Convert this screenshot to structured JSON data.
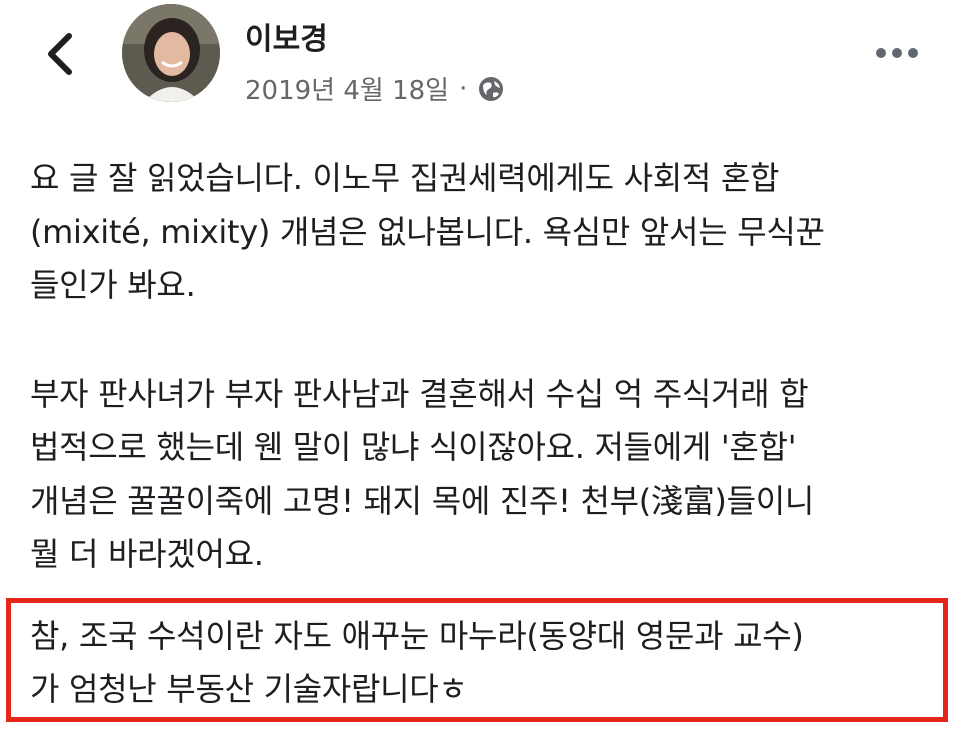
{
  "header": {
    "back_icon": "chevron-left-icon",
    "author_name": "이보경",
    "date": "2019년 4월 18일",
    "separator": "·",
    "privacy_icon": "globe-icon",
    "more_icon": "more-horizontal-icon"
  },
  "post": {
    "para1": "요 글 잘 읽었습니다. 이노무 집권세력에게도 사회적 혼합\n(mixité, mixity) 개념은 없나봅니다. 욕심만 앞서는 무식꾼\n들인가 봐요.",
    "para2": "부자 판사녀가 부자 판사남과 결혼해서 수십 억 주식거래 합\n법적으로 했는데 웬 말이 많냐 식이잖아요. 저들에게 '혼합'\n개념은 꿀꿀이죽에 고명! 돼지 목에 진주! 천부(淺富)들이니\n뭘 더 바라겠어요.",
    "para3": "참, 조국 수석이란 자도 애꾸눈 마누라(동양대 영문과 교수)\n가 엄청난 부동산 기술자랍니다ㅎ"
  },
  "colors": {
    "text": "#1c1e21",
    "meta": "#65676b",
    "highlight_border": "#e8251b"
  }
}
